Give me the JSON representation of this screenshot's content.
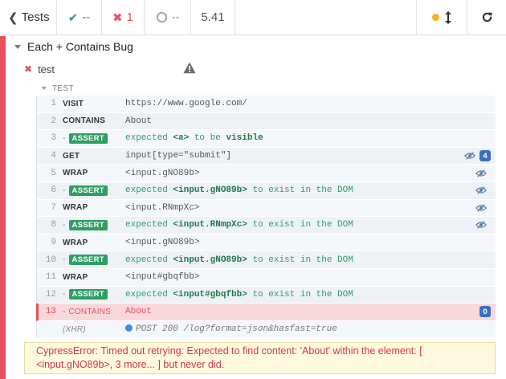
{
  "header": {
    "tests_label": "Tests",
    "passed": "--",
    "failed": "1",
    "pending": "--",
    "duration": "5.41"
  },
  "colors": {
    "fail": "#e94f5f",
    "pass": "#2e9e63",
    "running": "#f5b21b",
    "badge": "#3a6ec3"
  },
  "suite": {
    "title": "Each + Contains Bug"
  },
  "test": {
    "title": "test"
  },
  "hook": {
    "title": "TEST"
  },
  "commands": [
    {
      "num": "1",
      "name": "VISIT",
      "message": "https://www.google.com/"
    },
    {
      "num": "2",
      "name": "CONTAINS",
      "message": "About"
    },
    {
      "num": "3",
      "name": "ASSERT",
      "child": true,
      "pre": "expected ",
      "sel": "<a>",
      "mid": " to be ",
      "post": "visible"
    },
    {
      "num": "4",
      "name": "GET",
      "message": "input[type=\"submit\"]",
      "eye": true,
      "count": "4"
    },
    {
      "num": "5",
      "name": "WRAP",
      "message": "<input.gNO89b>",
      "eye": true
    },
    {
      "num": "6",
      "name": "ASSERT",
      "child": true,
      "pre": "expected ",
      "sel": "<input.gNO89b>",
      "mid": " to exist in the DOM",
      "eye": true
    },
    {
      "num": "7",
      "name": "WRAP",
      "message": "<input.RNmpXc>",
      "eye": true
    },
    {
      "num": "8",
      "name": "ASSERT",
      "child": true,
      "pre": "expected ",
      "sel": "<input.RNmpXc>",
      "mid": " to exist in the DOM",
      "eye": true
    },
    {
      "num": "9",
      "name": "WRAP",
      "message": "<input.gNO89b>"
    },
    {
      "num": "10",
      "name": "ASSERT",
      "child": true,
      "pre": "expected ",
      "sel": "<input.gNO89b>",
      "mid": " to exist in the DOM"
    },
    {
      "num": "11",
      "name": "WRAP",
      "message": "<input#gbqfbb>"
    },
    {
      "num": "12",
      "name": "ASSERT",
      "child": true,
      "pre": "expected ",
      "sel": "<input#gbqfbb>",
      "mid": " to exist in the DOM"
    },
    {
      "num": "13",
      "name": "CONTAINS",
      "child": true,
      "failed": true,
      "message": "About",
      "count": "0"
    }
  ],
  "xhr": {
    "name": "(XHR)",
    "message": "POST 200 /log?format=json&hasfast=true"
  },
  "error": {
    "text": "CypressError: Timed out retrying: Expected to find content: 'About' within the element: [ <input.gNO89b>, 3 more... ] but never did."
  }
}
